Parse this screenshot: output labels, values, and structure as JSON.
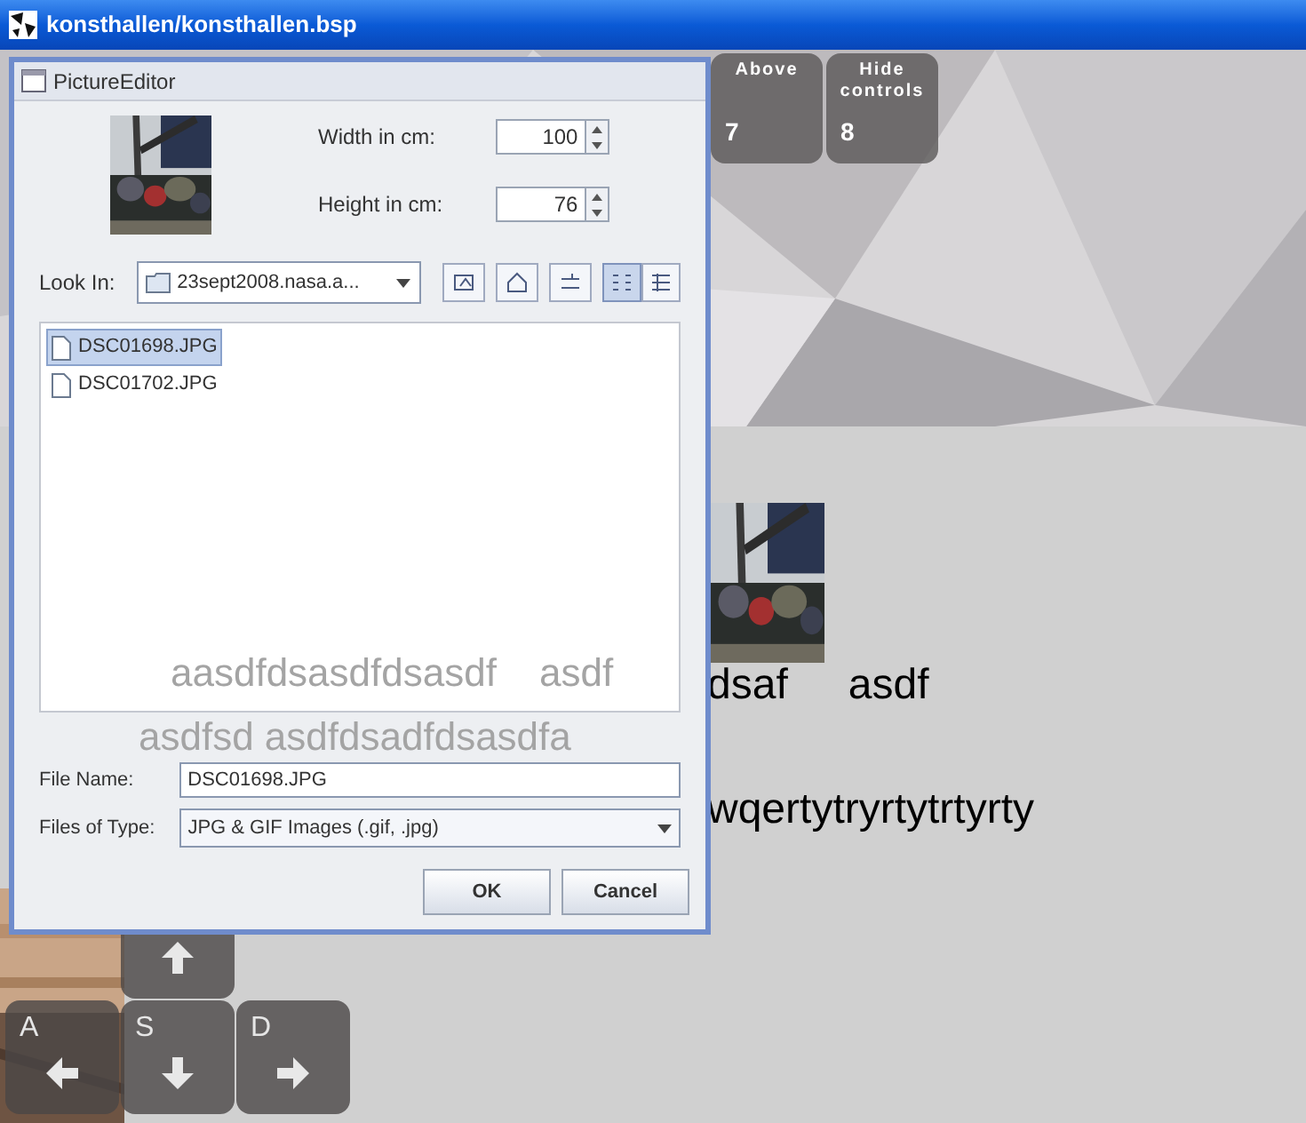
{
  "window": {
    "title": "konsthallen/konsthallen.bsp"
  },
  "hud_keys": [
    {
      "label": "Above",
      "key": "7"
    },
    {
      "label": "Hide controls",
      "key": "8"
    }
  ],
  "movement_keys": [
    {
      "kind": "up"
    },
    {
      "kind": "left",
      "letter": "A"
    },
    {
      "kind": "down",
      "letter": "S"
    },
    {
      "kind": "right",
      "letter": "D"
    }
  ],
  "scene_lines": [
    [
      "dsaf",
      "asdf"
    ],
    [
      "wqertytryrtytrtyrty"
    ]
  ],
  "dialog": {
    "title": "PictureEditor",
    "width_label": "Width in cm:",
    "width_value": "100",
    "height_label": "Height in cm:",
    "height_value": "76",
    "look_in_label": "Look In:",
    "look_in_value": "23sept2008.nasa.a...",
    "view_buttons": [
      {
        "selected": true
      },
      {
        "selected": false
      }
    ],
    "files": [
      {
        "name": "DSC01698.JPG",
        "selected": true
      },
      {
        "name": "DSC01702.JPG",
        "selected": false
      }
    ],
    "faded_lines": [
      [
        "aasdfdsasdfdsasdf",
        "asdf"
      ],
      [
        "asdfsd asdfdsadfdsasdfa"
      ]
    ],
    "file_name_label": "File Name:",
    "file_name_value": "DSC01698.JPG",
    "files_of_type_label": "Files of Type:",
    "files_of_type_value": "JPG & GIF Images (.gif, .jpg)",
    "buttons": [
      "OK",
      "Cancel"
    ]
  }
}
